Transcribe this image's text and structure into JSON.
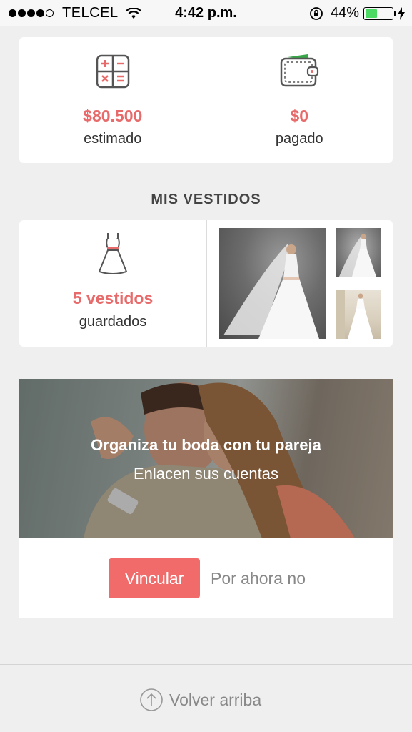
{
  "status_bar": {
    "carrier": "TELCEL",
    "time": "4:42 p.m.",
    "battery": "44%",
    "battery_level": 0.44,
    "signal_bars": 4
  },
  "budget": {
    "estimated_amount": "$80.500",
    "estimated_label": "estimado",
    "paid_amount": "$0",
    "paid_label": "pagado"
  },
  "dresses": {
    "section_title": "MIS VESTIDOS",
    "count_label": "5 vestidos",
    "saved_label": "guardados"
  },
  "couple": {
    "title": "Organiza tu boda con tu pareja",
    "subtitle": "Enlacen sus cuentas",
    "link_button": "Vincular",
    "later_button": "Por ahora no"
  },
  "footer": {
    "back_to_top": "Volver arriba"
  },
  "colors": {
    "accent": "#e86b6b",
    "button": "#f26b6b",
    "battery": "#4cd964"
  }
}
